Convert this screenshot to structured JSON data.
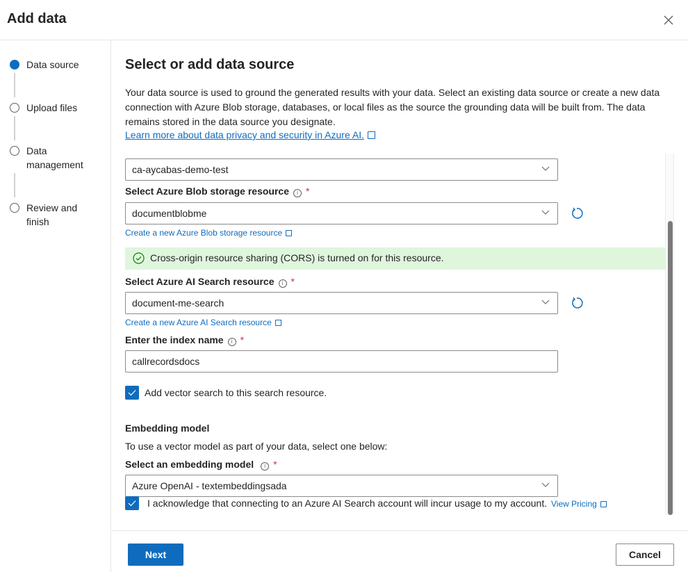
{
  "dialog": {
    "title": "Add data",
    "close_icon": "close-icon"
  },
  "steps": [
    {
      "label": "Data source",
      "state": "active"
    },
    {
      "label": "Upload files",
      "state": "pending"
    },
    {
      "label": "Data management",
      "state": "pending"
    },
    {
      "label": "Review and finish",
      "state": "pending"
    }
  ],
  "main": {
    "heading": "Select or add data source",
    "description": "Your data source is used to ground the generated results with your data. Select an existing data source or create a new data connection with Azure Blob storage, databases, or local files as the source the grounding data will be built from. The data remains stored in the data source you designate.",
    "learn_more_link": "Learn more about data privacy and security in Azure AI."
  },
  "form": {
    "subscription_dropdown": {
      "value": "ca-aycabas-demo-test"
    },
    "blob_storage": {
      "label": "Select Azure Blob storage resource",
      "required_mark": "*",
      "value": "documentblobme",
      "create_link": "Create a new Azure Blob storage resource"
    },
    "cors_message": {
      "text": "Cross-origin resource sharing (CORS) is turned on for this resource.",
      "status": "success",
      "color": "#dff6dd"
    },
    "search_resource": {
      "label": "Select Azure AI Search resource",
      "required_mark": "*",
      "value": "document-me-search",
      "create_link": "Create a new Azure AI Search resource"
    },
    "index_name": {
      "label": "Enter the index name",
      "required_mark": "*",
      "value": "callrecordsdocs"
    },
    "vector_search_checkbox": {
      "label": "Add vector search to this search resource.",
      "checked": true
    },
    "embedding": {
      "section_title": "Embedding model",
      "hint": "To use a vector model as part of your data, select one below:",
      "label": "Select an embedding model",
      "required_mark": "*",
      "value": "Azure OpenAI - textembeddingsada"
    },
    "acknowledge_checkbox": {
      "label": "I acknowledge that connecting to an Azure AI Search account will incur usage to my account.",
      "checked": true,
      "link": "View Pricing"
    }
  },
  "footer": {
    "next_label": "Next",
    "cancel_label": "Cancel"
  },
  "colors": {
    "accent": "#0f6cbd",
    "required": "#c4314b",
    "success_bg": "#dff6dd"
  }
}
